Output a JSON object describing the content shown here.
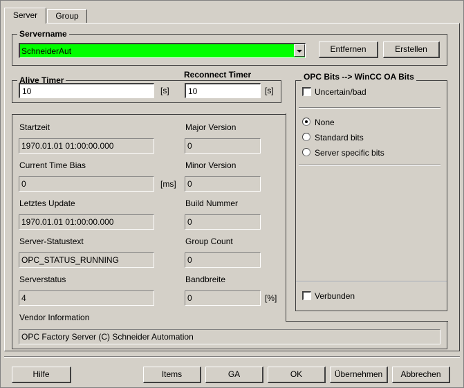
{
  "tabs": [
    {
      "label": "Server",
      "active": true
    },
    {
      "label": "Group",
      "active": false
    }
  ],
  "servername": {
    "legend": "Servername",
    "value": "SchneiderAut",
    "highlight_color": "#00ff00",
    "remove_label": "Entfernen",
    "create_label": "Erstellen"
  },
  "alive_timer": {
    "legend": "Alive Timer",
    "value": "10",
    "unit": "[s]"
  },
  "reconnect_timer": {
    "legend": "Reconnect Timer",
    "value": "10",
    "unit": "[s]"
  },
  "status": {
    "start_time": {
      "label": "Startzeit",
      "value": "1970.01.01 01:00:00.000"
    },
    "major_version": {
      "label": "Major Version",
      "value": "0"
    },
    "time_bias": {
      "label": "Current Time Bias",
      "value": "0",
      "unit": "[ms]"
    },
    "minor_version": {
      "label": "Minor Version",
      "value": "0"
    },
    "last_update": {
      "label": "Letztes Update",
      "value": "1970.01.01 01:00:00.000"
    },
    "build_number": {
      "label": "Build Nummer",
      "value": "0"
    },
    "status_text": {
      "label": "Server-Statustext",
      "value": "OPC_STATUS_RUNNING"
    },
    "group_count": {
      "label": "Group Count",
      "value": "0"
    },
    "server_status": {
      "label": "Serverstatus",
      "value": "4"
    },
    "bandwidth": {
      "label": "Bandbreite",
      "value": "0",
      "unit": "[%]"
    },
    "vendor_info": {
      "label": "Vendor Information",
      "value": "OPC Factory Server (C) Schneider Automation"
    }
  },
  "opc_bits": {
    "legend": "OPC Bits --> WinCC OA Bits",
    "uncertain": {
      "label": "Uncertain/bad",
      "checked": false
    },
    "radios": [
      {
        "label": "None",
        "checked": true
      },
      {
        "label": "Standard bits",
        "checked": false
      },
      {
        "label": "Server specific bits",
        "checked": false
      }
    ],
    "connected": {
      "label": "Verbunden",
      "checked": false
    }
  },
  "buttons": {
    "help": "Hilfe",
    "items": "Items",
    "ga": "GA",
    "ok": "OK",
    "apply": "Übernehmen",
    "cancel": "Abbrechen"
  }
}
